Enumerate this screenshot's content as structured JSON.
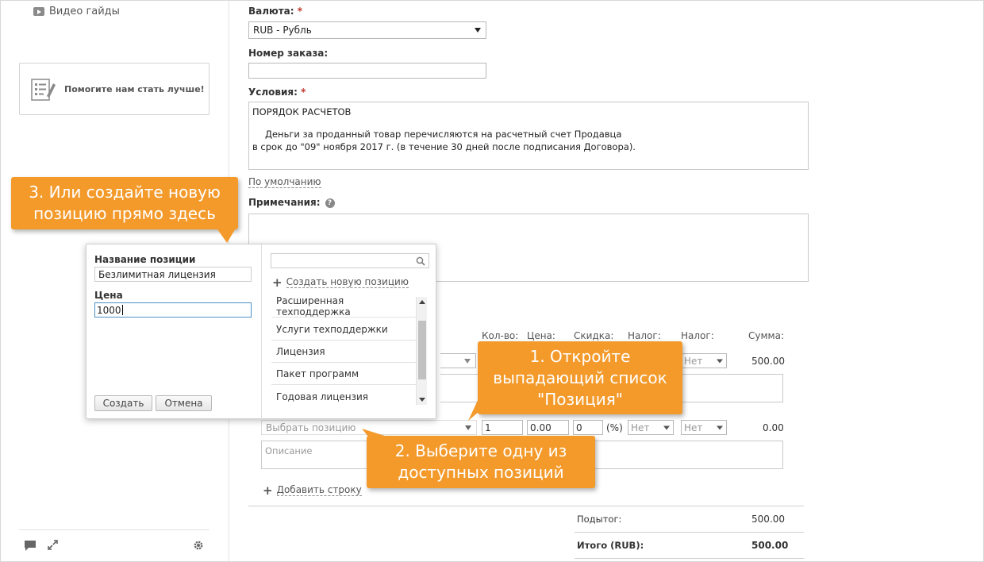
{
  "sidebar": {
    "video_guides": "Видео гайды",
    "feedback": "Помогите нам стать лучше!"
  },
  "form": {
    "currency_label": "Валюта:",
    "currency_value": "RUB - Рубль",
    "order_number_label": "Номер заказа:",
    "order_number_value": "",
    "terms_label": "Условия:",
    "required_mark": "*",
    "terms_line1": "ПОРЯДОК РАСЧЕТОВ",
    "terms_line2": "Деньги  за  проданный товар перечисляются на расчетный счет Продавца",
    "terms_line3": "в срок до \"09\" ноября 2017 г. (в течение 30 дней после подписания Договора).",
    "default_link": "По умолчанию",
    "notes_label": "Примечания:",
    "notes_value": ""
  },
  "table": {
    "headers": {
      "qty": "Кол-во:",
      "price": "Цена:",
      "discount": "Скидка:",
      "tax1": "Налог:",
      "tax2": "Налог:",
      "sum": "Сумма:"
    },
    "row1": {
      "tax2": "Нет",
      "sum": "500.00"
    },
    "row2": {
      "position_placeholder": "Выбрать позицию",
      "qty": "1",
      "price": "0.00",
      "discount": "0",
      "percent": "(%)",
      "tax1": "Нет",
      "tax2": "Нет",
      "sum": "0.00",
      "description_placeholder": "Описание"
    },
    "add_row": "Добавить строку"
  },
  "totals": {
    "subtotal_label": "Подытог:",
    "subtotal_value": "500.00",
    "total_label": "Итого (RUB):",
    "total_value": "500.00"
  },
  "popover": {
    "name_label": "Название позиции",
    "name_value": "Безлимитная лицензия",
    "price_label": "Цена",
    "price_value": "1000",
    "create_button": "Создать",
    "cancel_button": "Отмена",
    "search_placeholder": "",
    "create_new_link": "Создать новую позицию",
    "items": [
      "Расширенная техподдержка",
      "Услуги техподдержки",
      "Лицензия",
      "Пакет программ",
      "Годовая лицензия"
    ]
  },
  "callouts": {
    "step1_line1": "1. Откройте",
    "step1_line2": "выпадающий список",
    "step1_line3": "\"Позиция\"",
    "step2_line1": "2. Выберите одну из",
    "step2_line2": "доступных позиций",
    "step3_line1": "3. Или создайте новую",
    "step3_line2": "позицию прямо здесь"
  },
  "colors": {
    "callout": "#f39a2b",
    "required": "#c0392b"
  }
}
